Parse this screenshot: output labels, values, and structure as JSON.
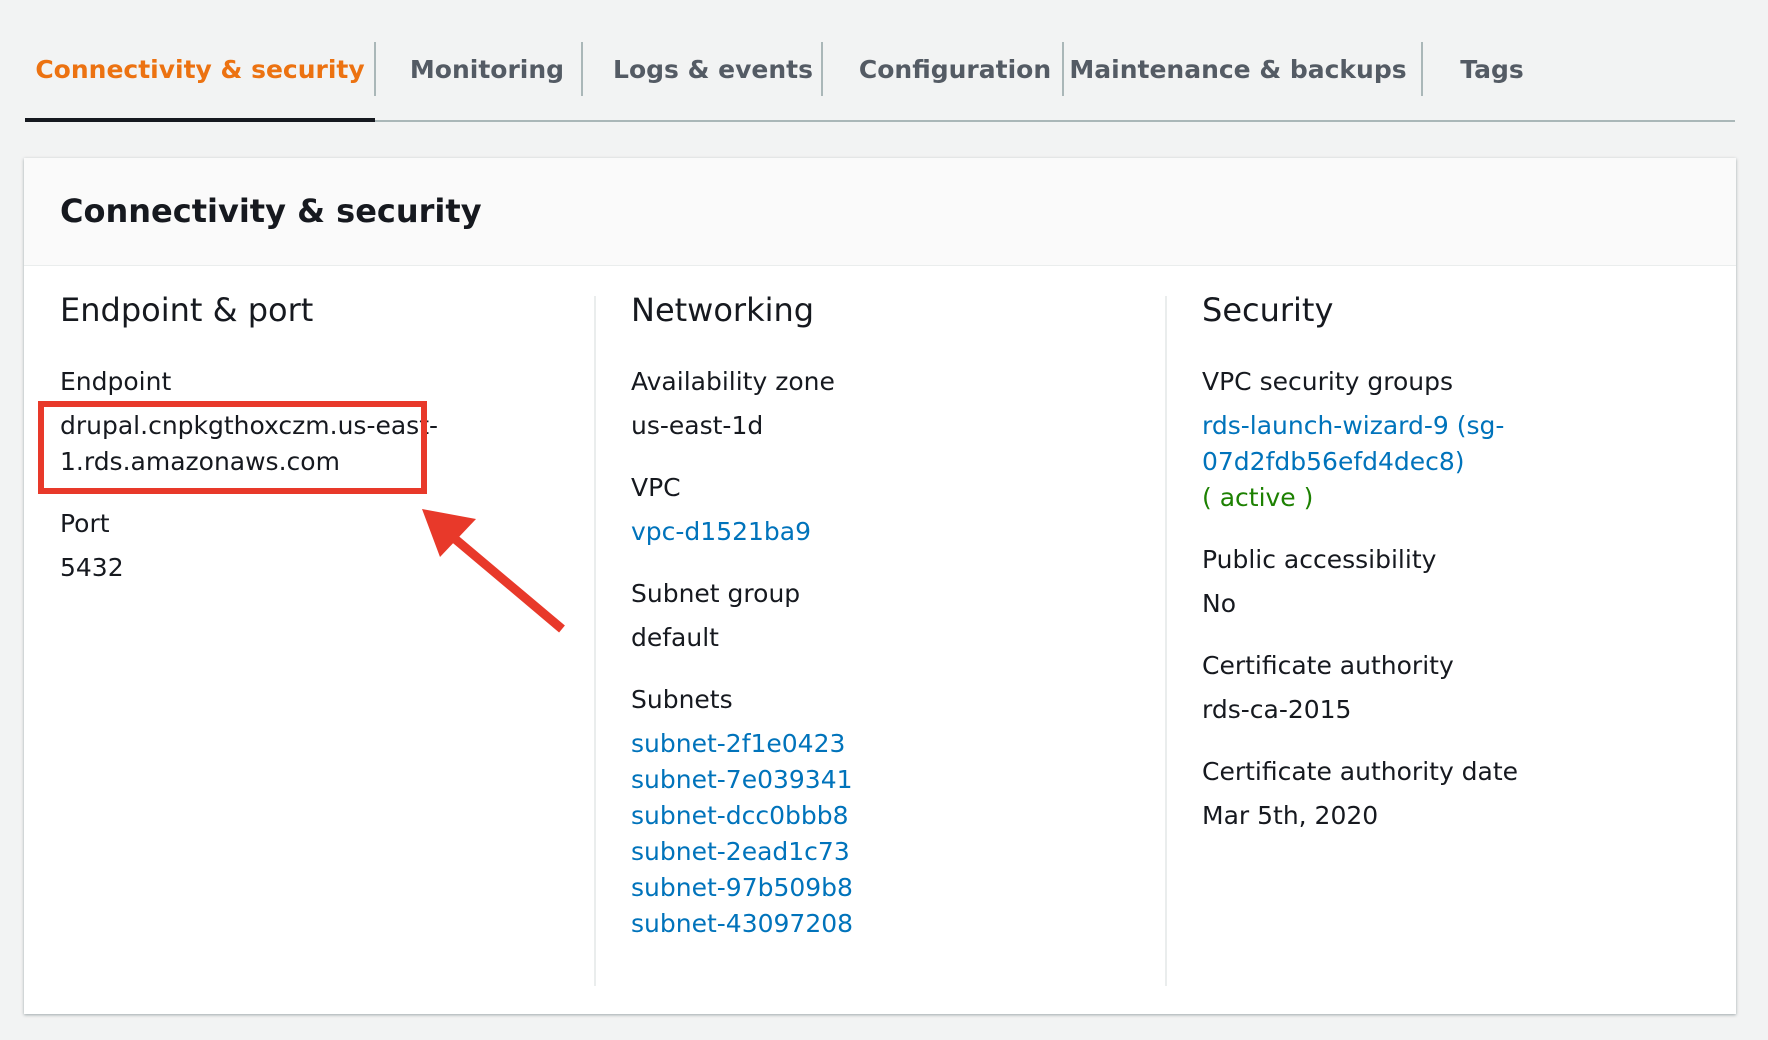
{
  "tabs": [
    {
      "label": "Connectivity & security",
      "active": true
    },
    {
      "label": "Monitoring",
      "active": false
    },
    {
      "label": "Logs & events",
      "active": false
    },
    {
      "label": "Configuration",
      "active": false
    },
    {
      "label": "Maintenance & backups",
      "active": false
    },
    {
      "label": "Tags",
      "active": false
    }
  ],
  "panel": {
    "title": "Connectivity & security",
    "endpoint_port": {
      "title": "Endpoint & port",
      "endpoint_label": "Endpoint",
      "endpoint_value_line1": "drupal.cnpkgthoxczm.us-east-",
      "endpoint_value_line2": "1.rds.amazonaws.com",
      "port_label": "Port",
      "port_value": "5432"
    },
    "networking": {
      "title": "Networking",
      "az_label": "Availability zone",
      "az_value": "us-east-1d",
      "vpc_label": "VPC",
      "vpc_value": "vpc-d1521ba9",
      "subnet_group_label": "Subnet group",
      "subnet_group_value": "default",
      "subnets_label": "Subnets",
      "subnets": [
        "subnet-2f1e0423",
        "subnet-7e039341",
        "subnet-dcc0bbb8",
        "subnet-2ead1c73",
        "subnet-97b509b8",
        "subnet-43097208"
      ]
    },
    "security": {
      "title": "Security",
      "sg_label": "VPC security groups",
      "sg_value_line1": "rds-launch-wizard-9 (sg-",
      "sg_value_line2": "07d2fdb56efd4dec8)",
      "sg_status": "( active )",
      "public_label": "Public accessibility",
      "public_value": "No",
      "ca_label": "Certificate authority",
      "ca_value": "rds-ca-2015",
      "ca_date_label": "Certificate authority date",
      "ca_date_value": "Mar 5th, 2020"
    }
  },
  "colors": {
    "accent": "#ec7211",
    "link": "#0073bb",
    "success": "#1d8102",
    "annotation": "#e8392a"
  }
}
